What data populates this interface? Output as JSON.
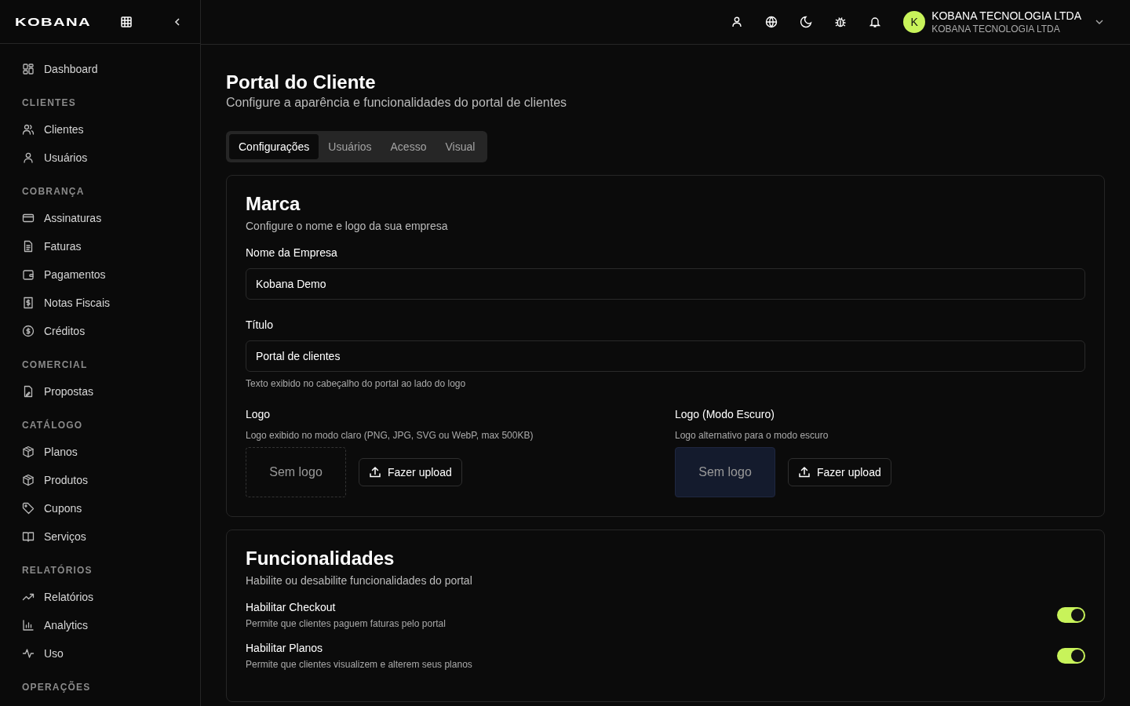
{
  "sidebar": {
    "logo": "KOBANA",
    "nav": [
      {
        "items": [
          {
            "label": "Dashboard",
            "selected": false
          }
        ]
      },
      {
        "heading": "CLIENTES",
        "items": [
          {
            "label": "Clientes",
            "selected": false
          },
          {
            "label": "Usuários",
            "selected": false
          }
        ]
      },
      {
        "heading": "COBRANÇA",
        "items": [
          {
            "label": "Assinaturas",
            "selected": false
          },
          {
            "label": "Faturas",
            "selected": false
          },
          {
            "label": "Pagamentos",
            "selected": false
          },
          {
            "label": "Notas Fiscais",
            "selected": false
          },
          {
            "label": "Créditos",
            "selected": false
          }
        ]
      },
      {
        "heading": "COMERCIAL",
        "items": [
          {
            "label": "Propostas",
            "selected": false
          }
        ]
      },
      {
        "heading": "CATÁLOGO",
        "items": [
          {
            "label": "Planos",
            "selected": false
          },
          {
            "label": "Produtos",
            "selected": false
          },
          {
            "label": "Cupons",
            "selected": false
          },
          {
            "label": "Serviços",
            "selected": false
          }
        ]
      },
      {
        "heading": "RELATÓRIOS",
        "items": [
          {
            "label": "Relatórios",
            "selected": false
          },
          {
            "label": "Analytics",
            "selected": false
          },
          {
            "label": "Uso",
            "selected": false
          }
        ]
      },
      {
        "heading": "OPERAÇÕES"
      }
    ]
  },
  "header": {
    "account": {
      "initial": "K",
      "name": "KOBANA TECNOLOGIA LTDA",
      "subtitle": "KOBANA TECNOLOGIA LTDA"
    }
  },
  "page": {
    "title": "Portal do Cliente",
    "subtitle": "Configure a aparência e funcionalidades do portal de clientes"
  },
  "tabs": [
    {
      "label": "Configurações",
      "selected": true
    },
    {
      "label": "Usuários",
      "selected": false
    },
    {
      "label": "Acesso",
      "selected": false
    },
    {
      "label": "Visual",
      "selected": false
    }
  ],
  "brand": {
    "title": "Marca",
    "subtitle": "Configure o nome e logo da sua empresa",
    "fields": [
      {
        "label": "Nome da Empresa",
        "value": "Kobana Demo"
      },
      {
        "label": "Título",
        "value": "Portal de clientes",
        "help": "Texto exibido no cabeçalho do portal ao lado do logo"
      }
    ],
    "logos": [
      {
        "label": "Logo",
        "help": "Logo exibido no modo claro (PNG, JPG, SVG ou WebP, max 500KB)",
        "preview": "Sem logo",
        "kind": "light",
        "button": "Fazer upload"
      },
      {
        "label": "Logo (Modo Escuro)",
        "help": "Logo alternativo para o modo escuro",
        "preview": "Sem logo",
        "kind": "dark",
        "button": "Fazer upload"
      }
    ]
  },
  "features": {
    "title": "Funcionalidades",
    "subtitle": "Habilite ou desabilite funcionalidades do portal",
    "items": [
      {
        "label": "Habilitar Checkout",
        "description": "Permite que clientes paguem faturas pelo portal",
        "on": true
      },
      {
        "label": "Habilitar Planos",
        "description": "Permite que clientes visualizem e alterem seus planos",
        "on": true
      }
    ]
  }
}
